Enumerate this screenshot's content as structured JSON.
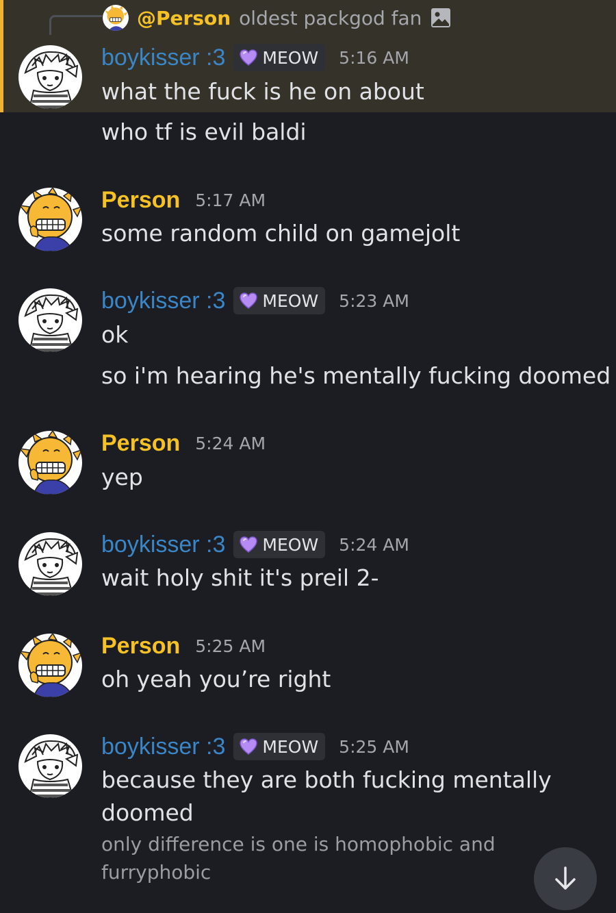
{
  "reply": {
    "name": "@Person",
    "text": "oldest packgod fan",
    "icon": "image-icon"
  },
  "users": {
    "boykisser": {
      "name": "boykisser :3",
      "color": "#3a86c7",
      "tag": "MEOW",
      "tag_icon": "purple-heart-icon"
    },
    "person": {
      "name": "Person",
      "color": "#f6c124"
    }
  },
  "messages": [
    {
      "user": "boykisser",
      "name": "boykisser :3",
      "tag": "MEOW",
      "time": "5:16 AM",
      "lines": [
        "what the fuck is he on about",
        "who tf is evil baldi"
      ],
      "highlighted": true
    },
    {
      "user": "person",
      "name": "Person",
      "time": "5:17 AM",
      "lines": [
        "some random child on gamejolt"
      ]
    },
    {
      "user": "boykisser",
      "name": "boykisser :3",
      "tag": "MEOW",
      "time": "5:23 AM",
      "lines": [
        "ok",
        "so i'm hearing he's mentally fucking doomed"
      ]
    },
    {
      "user": "person",
      "name": "Person",
      "time": "5:24 AM",
      "lines": [
        "yep"
      ]
    },
    {
      "user": "boykisser",
      "name": "boykisser :3",
      "tag": "MEOW",
      "time": "5:24 AM",
      "lines": [
        "wait holy shit it's preil 2-"
      ]
    },
    {
      "user": "person",
      "name": "Person",
      "time": "5:25 AM",
      "lines": [
        "oh yeah you’re right"
      ]
    },
    {
      "user": "boykisser",
      "name": "boykisser :3",
      "tag": "MEOW",
      "time": "5:25 AM",
      "lines": [
        "because they are both fucking mentally",
        "doomed"
      ],
      "subtext": [
        "only difference is one is homophobic and",
        "furryphobic"
      ]
    }
  ],
  "scroll_button": {
    "icon": "arrow-down-icon"
  }
}
